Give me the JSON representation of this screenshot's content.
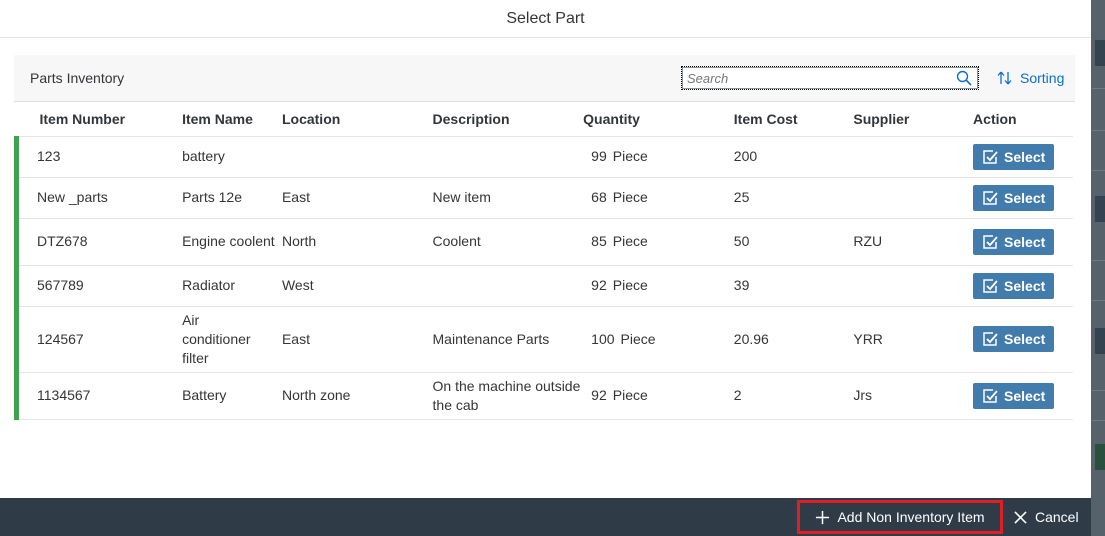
{
  "dialog": {
    "title": "Select Part"
  },
  "toolbar": {
    "title": "Parts Inventory",
    "search_placeholder": "Search",
    "search_value": "",
    "sort_label": "Sorting"
  },
  "table": {
    "columns": [
      "Item Number",
      "Item Name",
      "Location",
      "Description",
      "Quantity",
      "Item Cost",
      "Supplier",
      "Action"
    ],
    "rows": [
      {
        "item_number": "123",
        "item_name": "battery",
        "location": "",
        "description": "",
        "quantity": "99",
        "unit": "Piece",
        "item_cost": "200",
        "supplier": "",
        "action": "Select"
      },
      {
        "item_number": "New _parts",
        "item_name": "Parts 12e",
        "location": "East",
        "description": "New item",
        "quantity": "68",
        "unit": "Piece",
        "item_cost": "25",
        "supplier": "",
        "action": "Select"
      },
      {
        "item_number": "DTZ678",
        "item_name": "Engine coolent",
        "location": "North",
        "description": "Coolent",
        "quantity": "85",
        "unit": "Piece",
        "item_cost": "50",
        "supplier": "RZU",
        "action": "Select"
      },
      {
        "item_number": "567789",
        "item_name": "Radiator",
        "location": "West",
        "description": "",
        "quantity": "92",
        "unit": "Piece",
        "item_cost": "39",
        "supplier": "",
        "action": "Select"
      },
      {
        "item_number": "124567",
        "item_name": "Air conditioner filter",
        "location": "East",
        "description": "Maintenance Parts",
        "quantity": "100",
        "unit": "Piece",
        "item_cost": "20.96",
        "supplier": "YRR",
        "action": "Select"
      },
      {
        "item_number": "1134567",
        "item_name": "Battery",
        "location": "North zone",
        "description": "On the machine outside the cab",
        "quantity": "92",
        "unit": "Piece",
        "item_cost": "2",
        "supplier": "Jrs",
        "action": "Select"
      }
    ]
  },
  "footer": {
    "add_label": "Add Non Inventory Item",
    "cancel_label": "Cancel"
  },
  "colors": {
    "accent": "#0a6ed1",
    "button": "#427cac",
    "row_indicator": "#3fa34d",
    "footer_bg": "#2f3c48",
    "highlight_border": "#e01e25"
  },
  "icons": {
    "search": "search-icon",
    "sort": "sort-icon",
    "select": "checkbox-check-icon",
    "add": "plus-icon",
    "cancel": "close-icon"
  }
}
